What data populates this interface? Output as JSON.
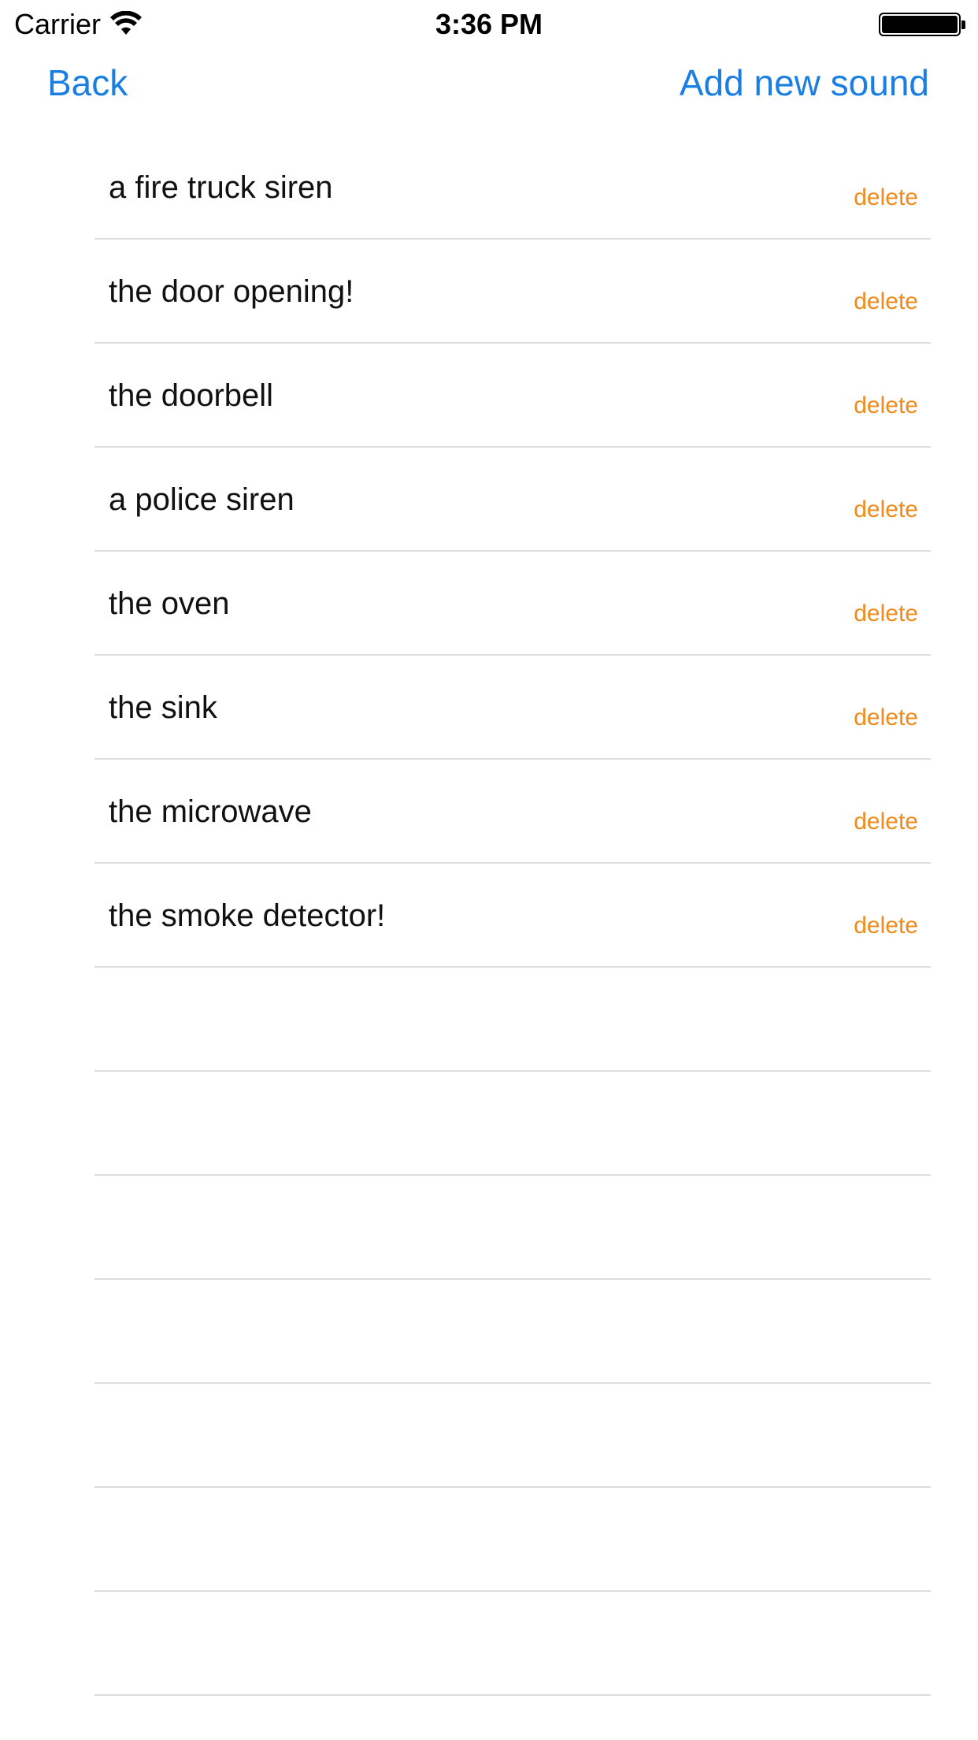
{
  "status_bar": {
    "carrier": "Carrier",
    "time": "3:36 PM",
    "wifi_icon": "wifi-icon",
    "battery_icon": "battery-icon"
  },
  "nav": {
    "back_label": "Back",
    "add_label": "Add new sound",
    "accent_color": "#1a7fe0"
  },
  "sounds": [
    {
      "label": "a fire truck siren",
      "action": "delete"
    },
    {
      "label": "the door opening!",
      "action": "delete"
    },
    {
      "label": "the doorbell",
      "action": "delete"
    },
    {
      "label": "a police siren",
      "action": "delete"
    },
    {
      "label": "the oven",
      "action": "delete"
    },
    {
      "label": "the sink",
      "action": "delete"
    },
    {
      "label": "the microwave",
      "action": "delete"
    },
    {
      "label": "the smoke detector!",
      "action": "delete"
    }
  ],
  "empty_rows": 7,
  "delete_color": "#f08a1c"
}
